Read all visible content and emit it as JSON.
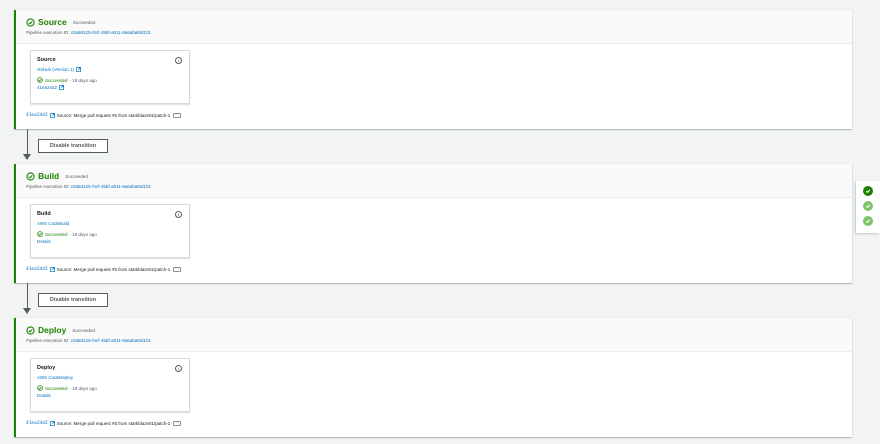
{
  "stages": [
    {
      "title": "Source",
      "status": "Succeeded",
      "exec_label": "Pipeline execution ID:",
      "exec_id": "c0a58125-f4cf-45bf-a011-8a6afa60d101",
      "action": {
        "name": "Source",
        "provider": "GitHub (Version 1)",
        "status": "Succeeded",
        "ago": "- 18 days ago",
        "extra": "41ea24d2",
        "info": "i"
      },
      "footer": {
        "commit": "41ea24d2",
        "text": "Source: Merge pull request #5 from starkblaze01/patch-1",
        "more": "···"
      }
    },
    {
      "title": "Build",
      "status": "Succeeded",
      "exec_label": "Pipeline execution ID:",
      "exec_id": "c0a58125-f4cf-45bf-a011-8a6afa60d101",
      "action": {
        "name": "Build",
        "provider": "AWS CodeBuild",
        "status": "Succeeded",
        "ago": "- 18 days ago",
        "extra": "Details",
        "info": "i"
      },
      "footer": {
        "commit": "41ea24d2",
        "text": "Source: Merge pull request #5 from starkblaze01/patch-1",
        "more": "···"
      }
    },
    {
      "title": "Deploy",
      "status": "Succeeded",
      "exec_label": "Pipeline execution ID:",
      "exec_id": "c0a58125-f4cf-45bf-a011-8a6afa60d101",
      "action": {
        "name": "Deploy",
        "provider": "AWS CodeDeploy",
        "status": "Succeeded",
        "ago": "- 18 days ago",
        "extra": "Details",
        "info": "i"
      },
      "footer": {
        "commit": "41ea24d2",
        "text": "Source: Merge pull request #5 from starkblaze01/patch-1",
        "more": "···"
      }
    }
  ],
  "transitions": [
    {
      "label": "Disable transition"
    },
    {
      "label": "Disable transition"
    }
  ],
  "colors": {
    "success": "#1d8102",
    "link": "#0073bb",
    "text_secondary": "#545b64",
    "panel_dot_active": "#1d8102",
    "panel_dot_inactive": "#7bc46a"
  },
  "icons": {
    "status": "check-circle-icon",
    "external": "external-link-icon",
    "info": "info-icon",
    "more": "ellipsis-icon"
  }
}
